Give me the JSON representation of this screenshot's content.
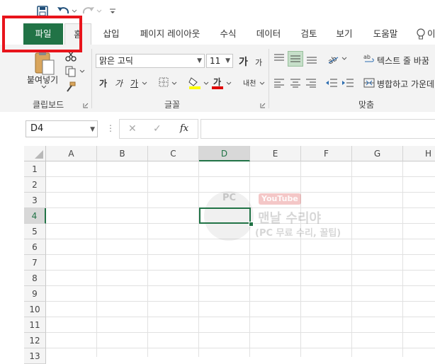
{
  "quick_access": {
    "save_icon": "save-icon",
    "undo_icon": "undo-icon",
    "redo_icon": "redo-icon",
    "customize_icon": "customize-icon"
  },
  "tabs": {
    "file": "파일",
    "home": "홈",
    "insert": "삽입",
    "page_layout": "페이지 레이아웃",
    "formulas": "수식",
    "data": "데이터",
    "review": "검토",
    "view": "보기",
    "help": "도움말",
    "tell_me_partial": "이"
  },
  "ribbon": {
    "clipboard": {
      "paste_label": "붙여넣기",
      "group_label": "클립보드"
    },
    "font": {
      "font_name": "맑은 고딕",
      "font_size": "11",
      "grow_label": "가",
      "shrink_label": "가",
      "bold": "가",
      "italic": "가",
      "underline": "가",
      "font_color_label": "가",
      "phonetic_label": "내천",
      "group_label": "글꼴"
    },
    "alignment": {
      "wrap_text": "텍스트 줄 바꿈",
      "merge_center": "병합하고 가운데",
      "group_label": "맞춤",
      "orientation_label": "가"
    }
  },
  "formula_bar": {
    "name_box": "D4",
    "cancel": "✕",
    "enter": "✓",
    "fx": "fx",
    "value": ""
  },
  "grid": {
    "columns": [
      "A",
      "B",
      "C",
      "D",
      "E",
      "F",
      "G",
      "H"
    ],
    "rows": [
      "1",
      "2",
      "3",
      "4",
      "5",
      "6",
      "7",
      "8",
      "9",
      "10",
      "11",
      "12",
      "13"
    ],
    "selected_column": "D",
    "selected_row": "4"
  },
  "watermark": {
    "pc_text": "PC",
    "youtube": "YouTube",
    "line1": "맨날 수리야",
    "line2": "(PC 무료 수리, 꿀팁)"
  },
  "colors": {
    "excel_green": "#217346",
    "highlight_red": "#e8141b"
  }
}
